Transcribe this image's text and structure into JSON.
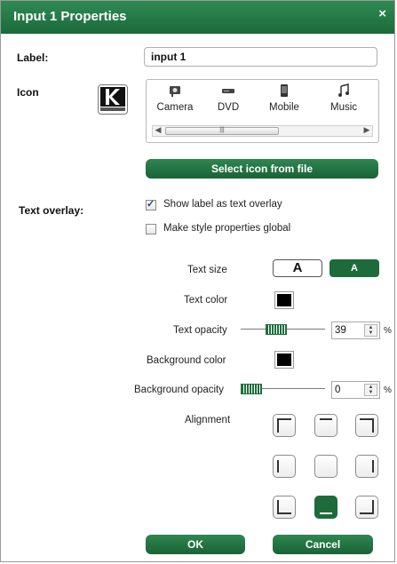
{
  "dialog": {
    "title": "Input 1 Properties",
    "close_glyph": "×"
  },
  "label_row": {
    "label": "Label:",
    "value": "input 1"
  },
  "icon_row": {
    "label": "Icon",
    "current_icon": "kramer-logo-icon",
    "items": [
      {
        "label": "Camera",
        "icon": "camera-icon"
      },
      {
        "label": "DVD",
        "icon": "dvd-icon"
      },
      {
        "label": "Mobile",
        "icon": "mobile-icon"
      },
      {
        "label": "Music",
        "icon": "music-icon"
      }
    ],
    "scroll_left": "◀",
    "scroll_right": "▶",
    "scroll_grip": "|||",
    "select_button": "Select icon from file"
  },
  "text_overlay": {
    "label": "Text overlay:",
    "show_label": {
      "text": "Show label as text overlay",
      "checked": true
    },
    "make_global": {
      "text": "Make style properties global",
      "checked": false
    }
  },
  "style": {
    "text_size_label": "Text size",
    "size_large": "A",
    "size_small": "A",
    "selected_size": "small",
    "text_color_label": "Text color",
    "text_color": "#000000",
    "text_opacity_label": "Text opacity",
    "text_opacity": "39",
    "text_opacity_unit": "%",
    "bg_color_label": "Background color",
    "bg_color": "#000000",
    "bg_opacity_label": "Background opacity",
    "bg_opacity": "0",
    "bg_opacity_unit": "%",
    "alignment_label": "Alignment",
    "alignment_selected": "bottom-center"
  },
  "buttons": {
    "ok": "OK",
    "cancel": "Cancel"
  },
  "colors": {
    "accent": "#1d6b3b",
    "title_bar": "#247a46"
  }
}
